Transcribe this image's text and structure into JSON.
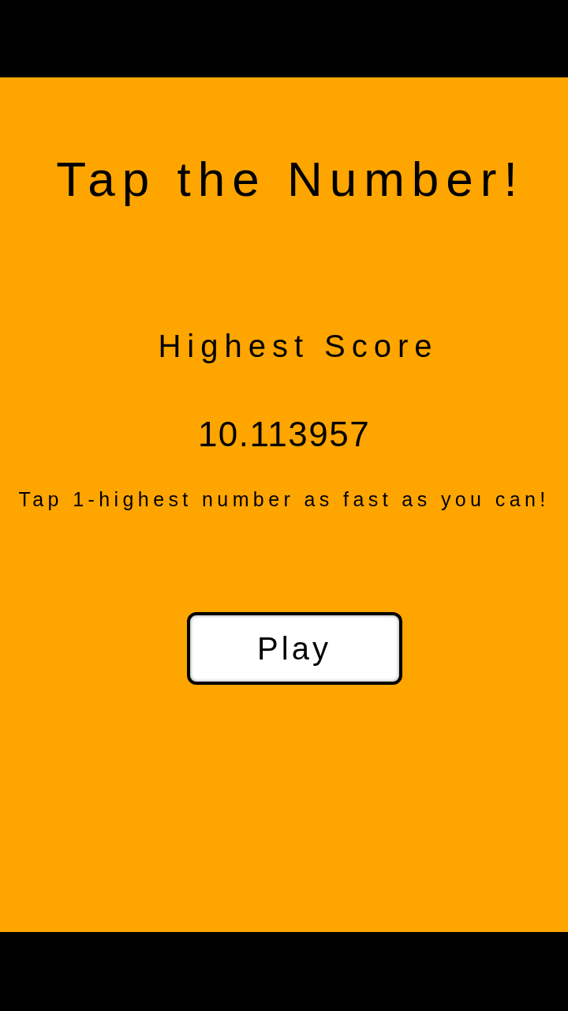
{
  "title": "Tap the Number!",
  "high_score": {
    "label": "Highest Score",
    "value": "10.113957"
  },
  "instructions": "Tap 1-highest number as fast as you can!",
  "buttons": [
    {
      "label": "Play"
    }
  ]
}
